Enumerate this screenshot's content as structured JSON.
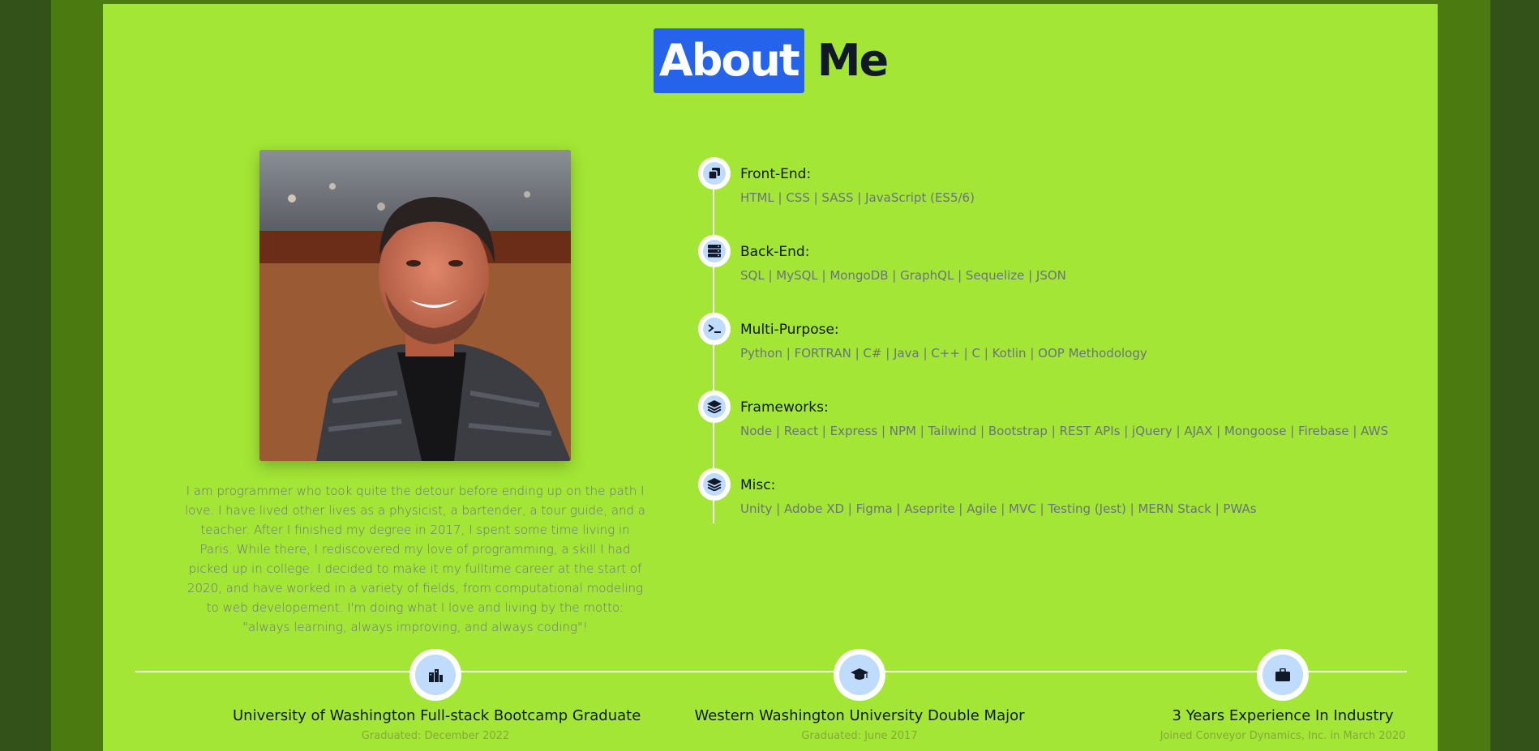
{
  "colors": {
    "page_bg": "#33521a",
    "frame_bg": "#4a7a10",
    "panel_bg": "#a3e635",
    "title_highlight": "#2563eb",
    "icon_circle": "#bfdbfe"
  },
  "header": {
    "title_highlight": "About",
    "title_rest": "Me"
  },
  "profile": {
    "photo_icon": "profile-photo",
    "bio": "I am programmer who took quite the detour before ending up on the path I love. I have lived other lives as a physicist, a bartender, a tour guide, and a teacher. After I finished my degree in 2017, I spent some time living in Paris. While there, I rediscovered my love of programming, a skill I had picked up in college. I decided to make it my fulltime career at the start of 2020, and have worked in a variety of fields, from computational modeling to web developement. I'm doing what I love and living by the motto: \"always learning, always improving, and always coding\"!"
  },
  "skills": [
    {
      "icon": "copy-icon",
      "title": "Front-End:",
      "list": "HTML | CSS | SASS | JavaScript (ES5/6)"
    },
    {
      "icon": "server-icon",
      "title": "Back-End:",
      "list": "SQL | MySQL | MongoDB | GraphQL | Sequelize | JSON"
    },
    {
      "icon": "terminal-icon",
      "title": "Multi-Purpose:",
      "list": "Python | FORTRAN | C# | Java | C++ | C | Kotlin | OOP Methodology"
    },
    {
      "icon": "layers-icon",
      "title": "Frameworks:",
      "list": "Node | React | Express | NPM | Tailwind | Bootstrap | REST APIs | jQuery | AJAX | Mongoose | Firebase | AWS"
    },
    {
      "icon": "layers-icon",
      "title": "Misc:",
      "list": "Unity | Adobe XD | Figma | Aseprite | Agile | MVC | Testing (Jest) | MERN Stack | PWAs"
    }
  ],
  "milestones": [
    {
      "icon": "city-icon",
      "title": "University of Washington Full-stack Bootcamp Graduate",
      "subtitle": "Graduated: December 2022"
    },
    {
      "icon": "graduation-cap-icon",
      "title": "Western Washington University Double Major",
      "subtitle": "Graduated: June 2017"
    },
    {
      "icon": "briefcase-icon",
      "title": "3 Years Experience In Industry",
      "subtitle": "Joined Conveyor Dynamics, Inc. in March 2020"
    }
  ]
}
